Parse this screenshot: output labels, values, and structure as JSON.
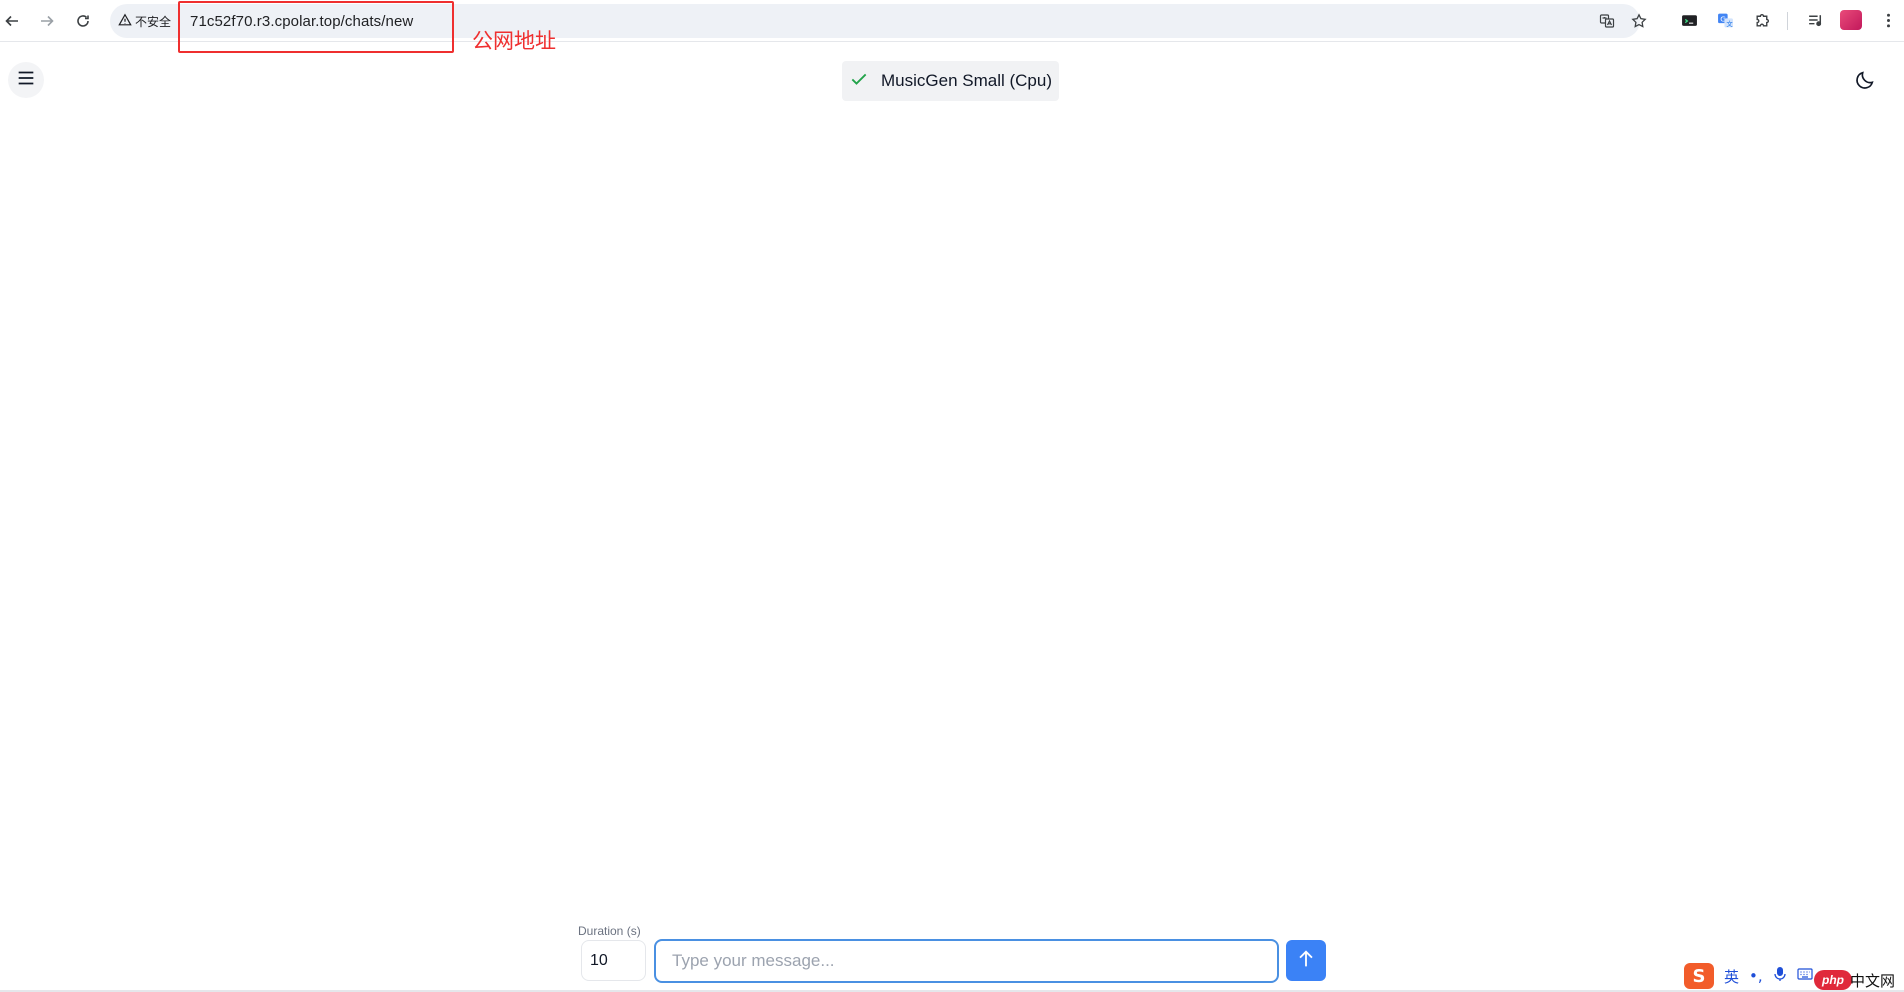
{
  "browser": {
    "security_label": "不安全",
    "url": "71c52f70.r3.cpolar.top/chats/new"
  },
  "annotation": {
    "label": "公网地址",
    "color": "#ef2f2f"
  },
  "header": {
    "model_name": "MusicGen Small (Cpu)",
    "model_status_color": "#22a34a"
  },
  "composer": {
    "duration_label": "Duration (s)",
    "duration_value": "10",
    "message_placeholder": "Type your message...",
    "send_color": "#3b82f6"
  },
  "ime": {
    "logo": "S",
    "mode": "英",
    "punct": "•,",
    "watermark_badge": "php",
    "watermark_text": "中文网"
  },
  "icons": [
    "back-arrow-icon",
    "forward-arrow-icon",
    "reload-icon",
    "warning-triangle-icon",
    "translate-icon",
    "star-icon",
    "terminal-icon",
    "translate-extension-icon",
    "puzzle-icon",
    "media-control-icon",
    "kebab-menu-icon",
    "hamburger-menu-icon",
    "check-icon",
    "moon-icon",
    "arrow-up-icon",
    "microphone-icon",
    "keyboard-icon"
  ]
}
